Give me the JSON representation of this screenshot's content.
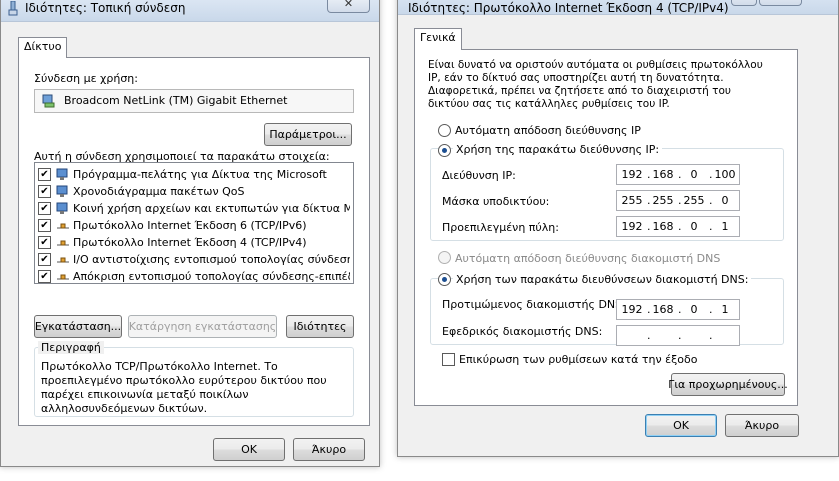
{
  "colors": {
    "window_bg": "#f0f0f0",
    "titlebar_start": "#dfe9f5",
    "titlebar_end": "#c9d8ea",
    "radio_dot": "#1d4f91"
  },
  "left": {
    "title": "Ιδιότητες: Τοπική σύνδεση",
    "tab_label": "Δίκτυο",
    "connect_using_label": "Σύνδεση με χρήση:",
    "adapter_name": "Broadcom NetLink (TM) Gigabit Ethernet",
    "configure_button": "Παράμετροι...",
    "items_label": "Αυτή η σύνδεση χρησιμοποιεί τα παρακάτω στοιχεία:",
    "items": [
      {
        "label": "Πρόγραμμα-πελάτης για Δίκτυα της Microsoft",
        "icon": "client-icon",
        "checked": true
      },
      {
        "label": "Χρονοδιάγραμμα πακέτων QoS",
        "icon": "qos-icon",
        "checked": true
      },
      {
        "label": "Κοινή χρήση αρχείων και εκτυπωτών για δίκτυα Micr...",
        "icon": "share-icon",
        "checked": true
      },
      {
        "label": "Πρωτόκολλο Internet Έκδοση 6 (TCP/IPv6)",
        "icon": "protocol-icon",
        "checked": true
      },
      {
        "label": "Πρωτόκολλο Internet Έκδοση 4 (TCP/IPv4)",
        "icon": "protocol-icon",
        "checked": true
      },
      {
        "label": "I/O αντιστοίχισης εντοπισμού τοπολογίας σύνδεση...",
        "icon": "protocol-icon",
        "checked": true
      },
      {
        "label": "Απόκριση εντοπισμού τοπολογίας σύνδεσης-επιπέδου",
        "icon": "protocol-icon",
        "checked": true
      }
    ],
    "install_button": "Εγκατάσταση...",
    "uninstall_button": "Κατάργηση εγκατάστασης",
    "properties_button": "Ιδιότητες",
    "description_legend": "Περιγραφή",
    "description_text": "Πρωτόκολλο TCP/Πρωτόκολλο Internet. Το προεπιλεγμένο πρωτόκολλο ευρύτερου δικτύου που παρέχει επικοινωνία μεταξύ ποικίλων αλληλοσυνδεόμενων δικτύων.",
    "ok_button": "OK",
    "cancel_button": "Άκυρο",
    "close_glyph": "✕"
  },
  "right": {
    "title": "Ιδιότητες: Πρωτόκολλο Internet Έκδοση 4 (TCP/IPv4)",
    "help_glyph": "?",
    "close_glyph": "✕",
    "tab_label": "Γενικά",
    "intro_text": "Είναι δυνατό να οριστούν αυτόματα οι ρυθμίσεις πρωτοκόλλου IP, εάν το δίκτυό σας υποστηρίζει αυτή τη δυνατότητα. Διαφορετικά, πρέπει να ζητήσετε από το διαχειριστή του δικτύου σας τις κατάλληλες ρυθμίσεις του IP.",
    "auto_ip_label": "Αυτόματη απόδοση διεύθυνσης IP",
    "manual_ip_label": "Χρήση της παρακάτω διεύθυνσης IP:",
    "ip_label": "Διεύθυνση IP:",
    "ip_value": [
      "192",
      "168",
      "0",
      "100"
    ],
    "subnet_label": "Μάσκα υποδικτύου:",
    "subnet_value": [
      "255",
      "255",
      "255",
      "0"
    ],
    "gateway_label": "Προεπιλεγμένη πύλη:",
    "gateway_value": [
      "192",
      "168",
      "0",
      "1"
    ],
    "auto_dns_label": "Αυτόματη απόδοση διεύθυνσης διακομιστή DNS",
    "manual_dns_label": "Χρήση των παρακάτω διευθύνσεων διακομιστή DNS:",
    "preferred_dns_label": "Προτιμώμενος διακομιστής DNS:",
    "preferred_dns_value": [
      "192",
      "168",
      "0",
      "1"
    ],
    "alternate_dns_label": "Εφεδρικός διακομιστής DNS:",
    "alternate_dns_value": [
      "",
      "",
      "",
      ""
    ],
    "validate_label": "Επικύρωση των ρυθμίσεων κατά την έξοδο",
    "advanced_button": "Για προχωρημένους...",
    "ok_button": "OK",
    "cancel_button": "Άκυρο"
  }
}
